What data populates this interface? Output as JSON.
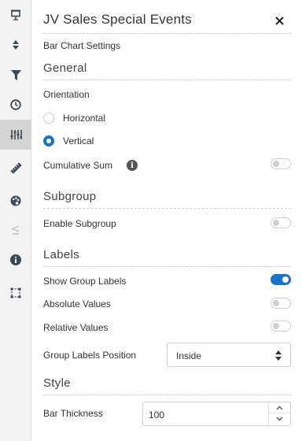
{
  "rail": {
    "items": [
      {
        "icon": "presentation-icon",
        "active": false
      },
      {
        "icon": "sort-icon",
        "active": false
      },
      {
        "icon": "filter-icon",
        "active": false
      },
      {
        "icon": "clock-icon",
        "active": false
      },
      {
        "icon": "sliders-icon",
        "active": true
      },
      {
        "icon": "ruler-icon",
        "active": false
      },
      {
        "icon": "palette-icon",
        "active": false
      },
      {
        "icon": "less-equal-icon",
        "active": false
      },
      {
        "icon": "info-icon",
        "active": false
      },
      {
        "icon": "selection-frame-icon",
        "active": false
      }
    ]
  },
  "header": {
    "title": "JV Sales Special Events",
    "close_glyph": "✕"
  },
  "subtitle": "Bar Chart Settings",
  "general": {
    "heading": "General",
    "orientation_label": "Orientation",
    "options": [
      {
        "label": "Horizontal",
        "checked": false
      },
      {
        "label": "Vertical",
        "checked": true
      }
    ],
    "cumulative_label": "Cumulative Sum",
    "cumulative_on": false
  },
  "subgroup": {
    "heading": "Subgroup",
    "enable_label": "Enable Subgroup",
    "enable_on": false
  },
  "labels": {
    "heading": "Labels",
    "show_group_label": "Show Group Labels",
    "show_group_on": true,
    "absolute_label": "Absolute Values",
    "absolute_on": false,
    "relative_label": "Relative Values",
    "relative_on": false,
    "position_label": "Group Labels Position",
    "position_value": "Inside"
  },
  "style": {
    "heading": "Style",
    "thickness_label": "Bar Thickness",
    "thickness_value": "100"
  },
  "colors": {
    "accent": "#1a73c8",
    "icon": "#3a4a5c"
  }
}
